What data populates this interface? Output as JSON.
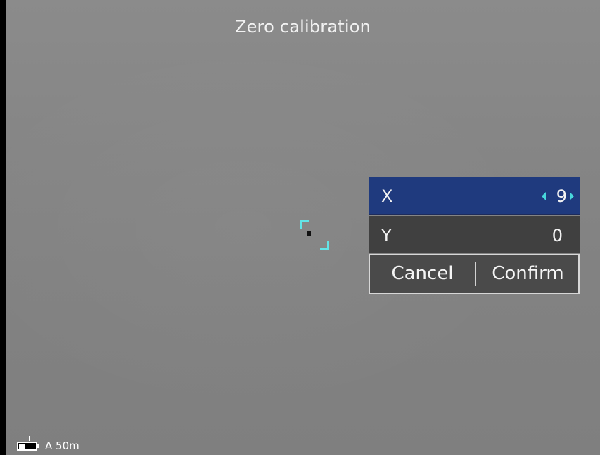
{
  "header": {
    "title": "Zero calibration"
  },
  "calibration": {
    "rows": [
      {
        "label": "X",
        "value": "9"
      },
      {
        "label": "Y",
        "value": "0"
      }
    ],
    "buttons": {
      "cancel": "Cancel",
      "confirm": "Confirm"
    }
  },
  "status": {
    "battery": {
      "level": 0.4
    },
    "range": "A 50m"
  },
  "colors": {
    "accent": "#48d7dc",
    "selected_row": "#1f3a7e",
    "row_bg": "#404040",
    "button_bg": "#4a4a4a"
  },
  "icons": {
    "reticle": "crosshair-brackets-icon",
    "left_arrow": "chevron-left-icon",
    "right_arrow": "chevron-right-icon",
    "battery": "battery-icon"
  }
}
